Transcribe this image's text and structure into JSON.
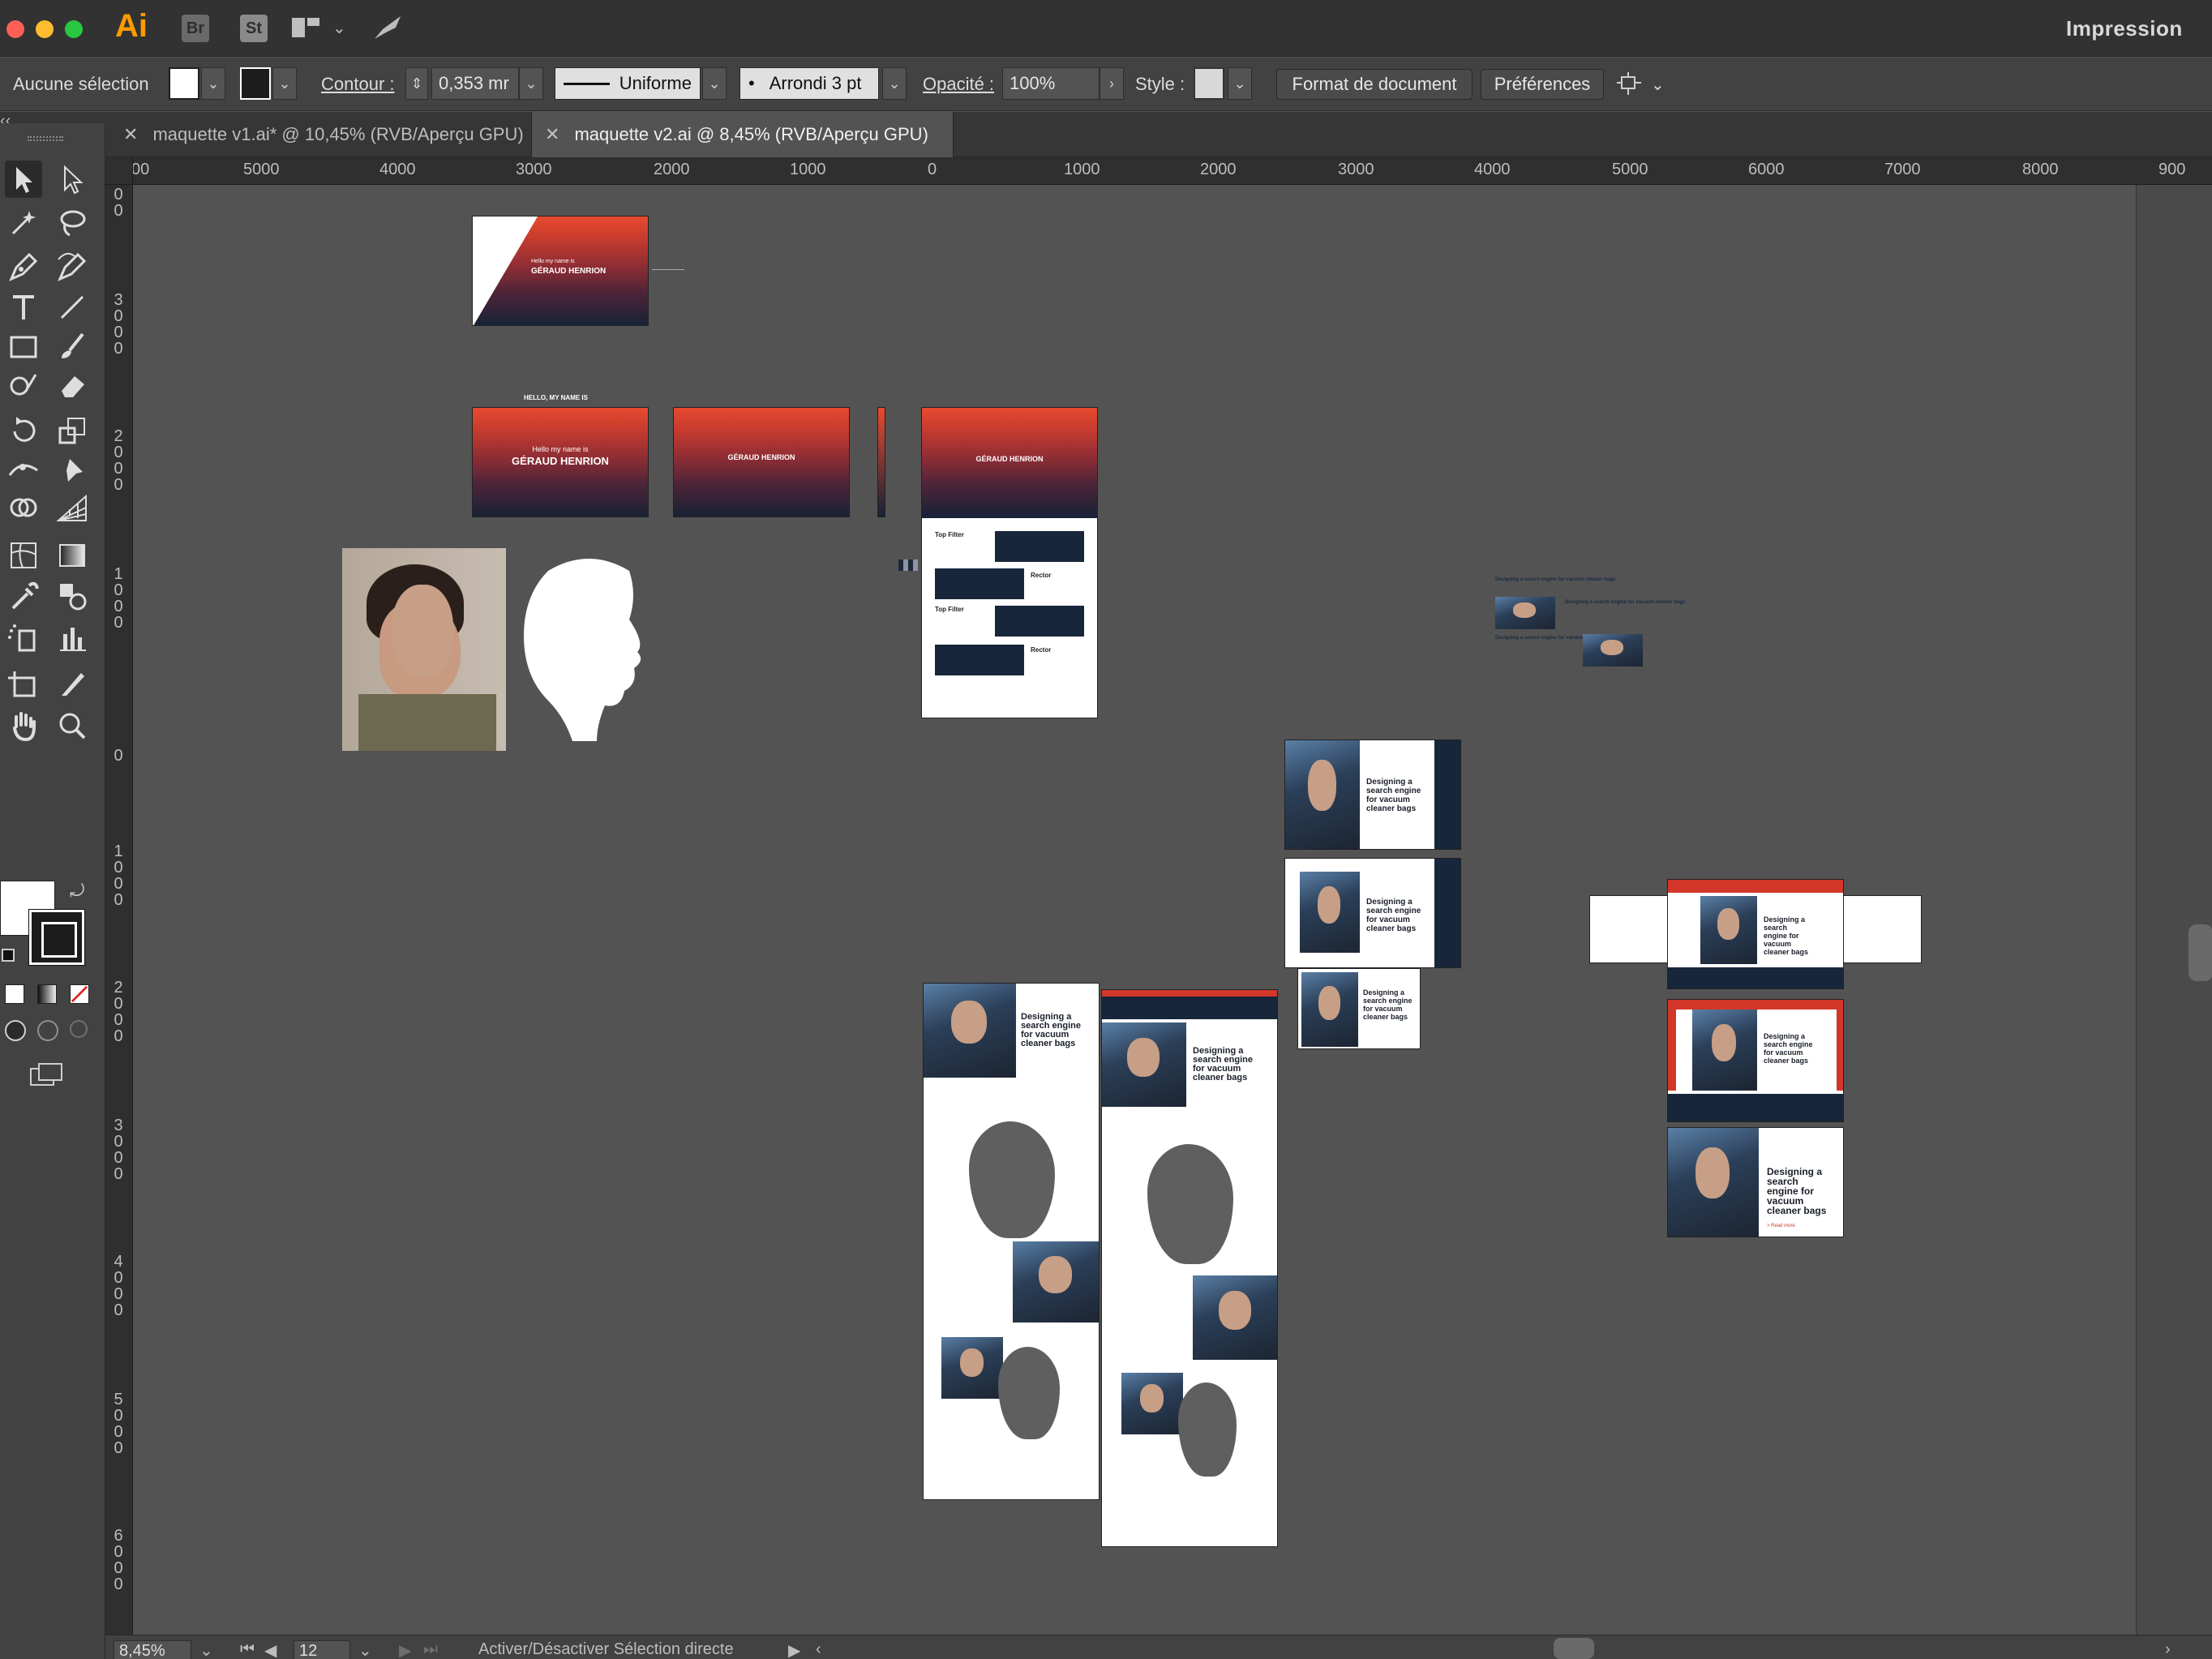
{
  "app": {
    "logo": "Ai",
    "bridge_label": "Br",
    "stock_label": "St",
    "workspace_label": "Impression"
  },
  "control_bar": {
    "selection": "Aucune sélection",
    "contour_label": "Contour :",
    "contour_value": "0,353 mr",
    "stroke_profile": "Uniforme",
    "brush_label": "Arrondi 3 pt",
    "opacity_label": "Opacité :",
    "opacity_value": "100%",
    "style_label": "Style :",
    "doc_format_button": "Format de document",
    "preferences_button": "Préférences"
  },
  "tabs": [
    {
      "label": "maquette v1.ai* @ 10,45% (RVB/Aperçu GPU)",
      "active": false
    },
    {
      "label": "maquette v2.ai @ 8,45% (RVB/Aperçu GPU)",
      "active": true
    }
  ],
  "ruler_h": [
    "00",
    "5000",
    "4000",
    "3000",
    "2000",
    "1000",
    "0",
    "1000",
    "2000",
    "3000",
    "4000",
    "5000",
    "6000",
    "7000",
    "8000",
    "900"
  ],
  "ruler_v": [
    "0\n0",
    "3\n0\n0\n0",
    "2\n0\n0\n0",
    "1\n0\n0\n0",
    "0",
    "1\n0\n0\n0",
    "2\n0\n0\n0",
    "3\n0\n0\n0",
    "4\n0\n0\n0",
    "5\n0\n0\n0",
    "6\n0\n0\n0"
  ],
  "artwork": {
    "hello_heading": "HELLO, MY NAME IS",
    "hello_line": "Hello my name is",
    "name": "GÉRAUD HENRION",
    "top_filter": "Top Filter",
    "rector": "Rector",
    "headline": "Designing a search engine for vacuum cleaner bags",
    "headline_small": "Designing a search engine for vacuum cleaner bags",
    "read_more": "> Read more"
  },
  "status_bar": {
    "zoom": "8,45%",
    "artboard": "12",
    "hint": "Activer/Désactiver Sélection directe"
  },
  "colors": {
    "app_accent": "#ff9a00",
    "canvas_bg": "#535353",
    "hero_red": "#e84a2f",
    "hero_navy": "#162236"
  }
}
